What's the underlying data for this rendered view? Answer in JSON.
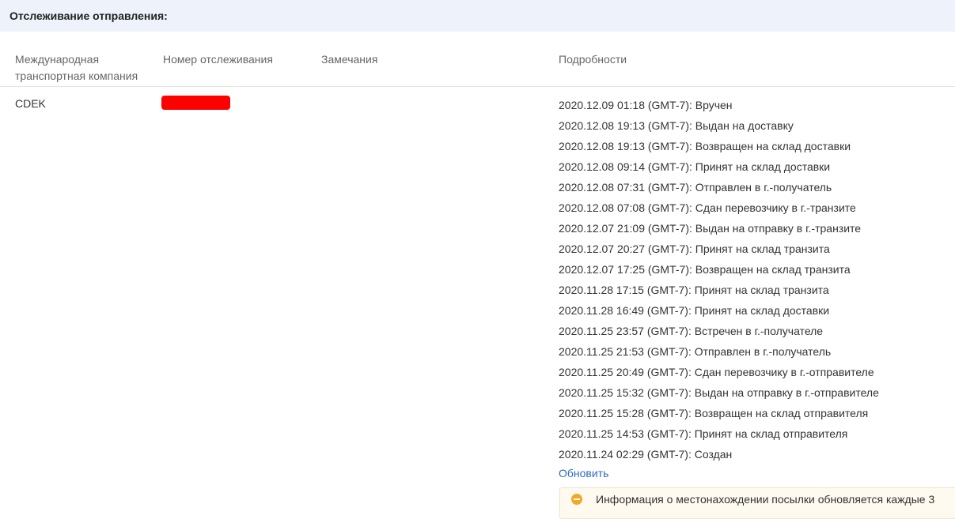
{
  "header": {
    "title": "Отслеживание отправления:"
  },
  "columns": {
    "carrier": "Международная транспортная компания",
    "tracking": "Номер отслеживания",
    "remarks": "Замечания",
    "details": "Подробности"
  },
  "row": {
    "carrier": "CDEK",
    "tracking_redaction_color": "#ff0000",
    "events": [
      "2020.12.09 01:18 (GMT-7): Вручен",
      "2020.12.08 19:13 (GMT-7): Выдан на доставку",
      "2020.12.08 19:13 (GMT-7): Возвращен на склад доставки",
      "2020.12.08 09:14 (GMT-7): Принят на склад доставки",
      "2020.12.08 07:31 (GMT-7): Отправлен в г.-получатель",
      "2020.12.08 07:08 (GMT-7): Сдан перевозчику в г.-транзите",
      "2020.12.07 21:09 (GMT-7): Выдан на отправку в г.-транзите",
      "2020.12.07 20:27 (GMT-7): Принят на склад транзита",
      "2020.12.07 17:25 (GMT-7): Возвращен на склад транзита",
      "2020.11.28 17:15 (GMT-7): Принят на склад транзита",
      "2020.11.28 16:49 (GMT-7): Принят на склад доставки",
      "2020.11.25 23:57 (GMT-7): Встречен в г.-получателе",
      "2020.11.25 21:53 (GMT-7): Отправлен в г.-получатель",
      "2020.11.25 20:49 (GMT-7): Сдан перевозчику в г.-отправителе",
      "2020.11.25 15:32 (GMT-7): Выдан на отправку в г.-отправителе",
      "2020.11.25 15:28 (GMT-7): Возвращен на склад отправителя",
      "2020.11.25 14:53 (GMT-7): Принят на склад отправителя",
      "2020.11.24 02:29 (GMT-7): Создан"
    ],
    "refresh_label": "Обновить"
  },
  "notice": {
    "icon": "warning-icon",
    "text": "Информация о местонахождении посылки обновляется каждые 3"
  },
  "colors": {
    "header_bg": "#eef3fb",
    "link": "#2d6bc4",
    "notice_icon": "#f5a623"
  }
}
